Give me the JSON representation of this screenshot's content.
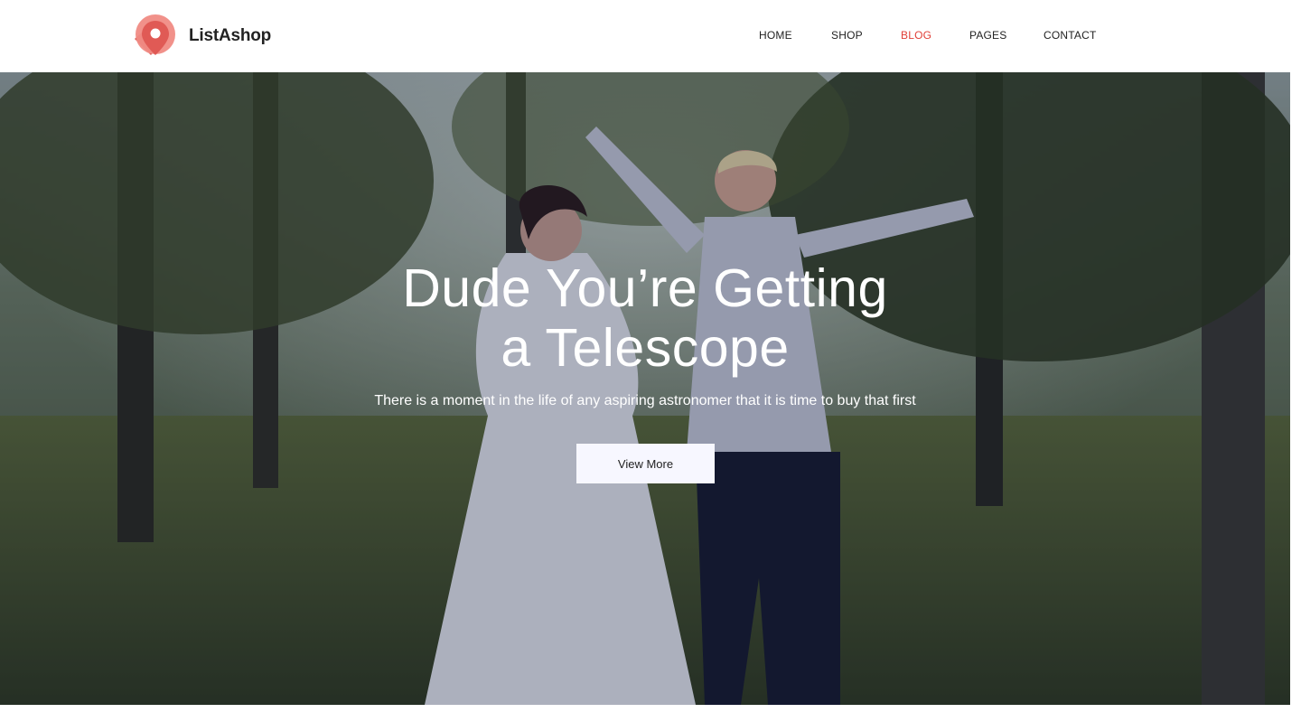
{
  "brand": {
    "name": "ListAshop",
    "logo_icon": "map-pin-tag-icon",
    "colors": {
      "logo_primary": "#e05a55",
      "logo_light": "#f08b84"
    }
  },
  "nav": {
    "items": [
      {
        "label": "HOME",
        "active": false
      },
      {
        "label": "SHOP",
        "active": false
      },
      {
        "label": "BLOG",
        "active": true
      },
      {
        "label": "PAGES",
        "active": false
      },
      {
        "label": "CONTACT",
        "active": false
      }
    ],
    "active_color": "#e03e36"
  },
  "hero": {
    "title_line1": "Dude You’re Getting",
    "title_line2": "a Telescope",
    "subtitle": "There is a moment in the life of any aspiring astronomer that it is time to buy that first",
    "button_label": "View More"
  }
}
